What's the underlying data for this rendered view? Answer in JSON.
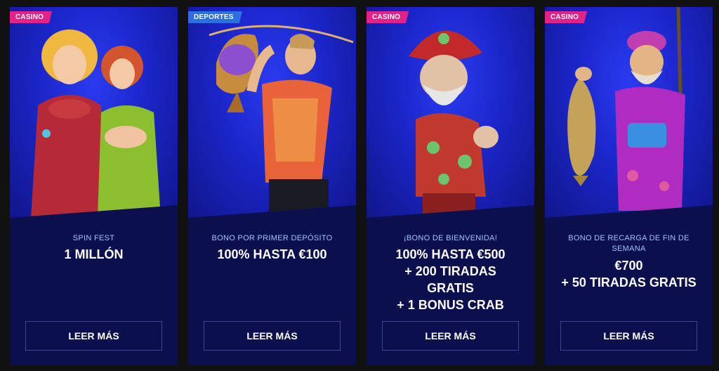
{
  "cards": [
    {
      "badge": "CASINO",
      "subtitle": "SPIN FEST",
      "headline": "1 MILLÓN",
      "button": "LEER MÁS",
      "image": "casino-women-characters"
    },
    {
      "badge": "DEPORTES",
      "subtitle": "BONO POR PRIMER DEPÓSITO",
      "headline": "100% HASTA €100",
      "button": "LEER MÁS",
      "image": "athlete-holding-trophy"
    },
    {
      "badge": "CASINO",
      "subtitle": "¡BONO DE BIENVENIDA!",
      "headline": "100% HASTA €500\n+ 200 TIRADAS\nGRATIS\n+ 1 BONUS CRAB",
      "button": "LEER MÁS",
      "image": "pirate-gnome-thumbs-up"
    },
    {
      "badge": "CASINO",
      "subtitle": "BONO DE RECARGA DE FIN DE SEMANA",
      "headline": "€700\n+ 50 TIRADAS GRATIS",
      "button": "LEER MÁS",
      "image": "fisherman-with-fish"
    }
  ],
  "colors": {
    "page_bg": "#111111",
    "card_bg": "#0c0f4d",
    "casino_badge": "#e0228a",
    "deportes_badge": "#2c6fe0",
    "subtitle_text": "#9ec3ff"
  }
}
